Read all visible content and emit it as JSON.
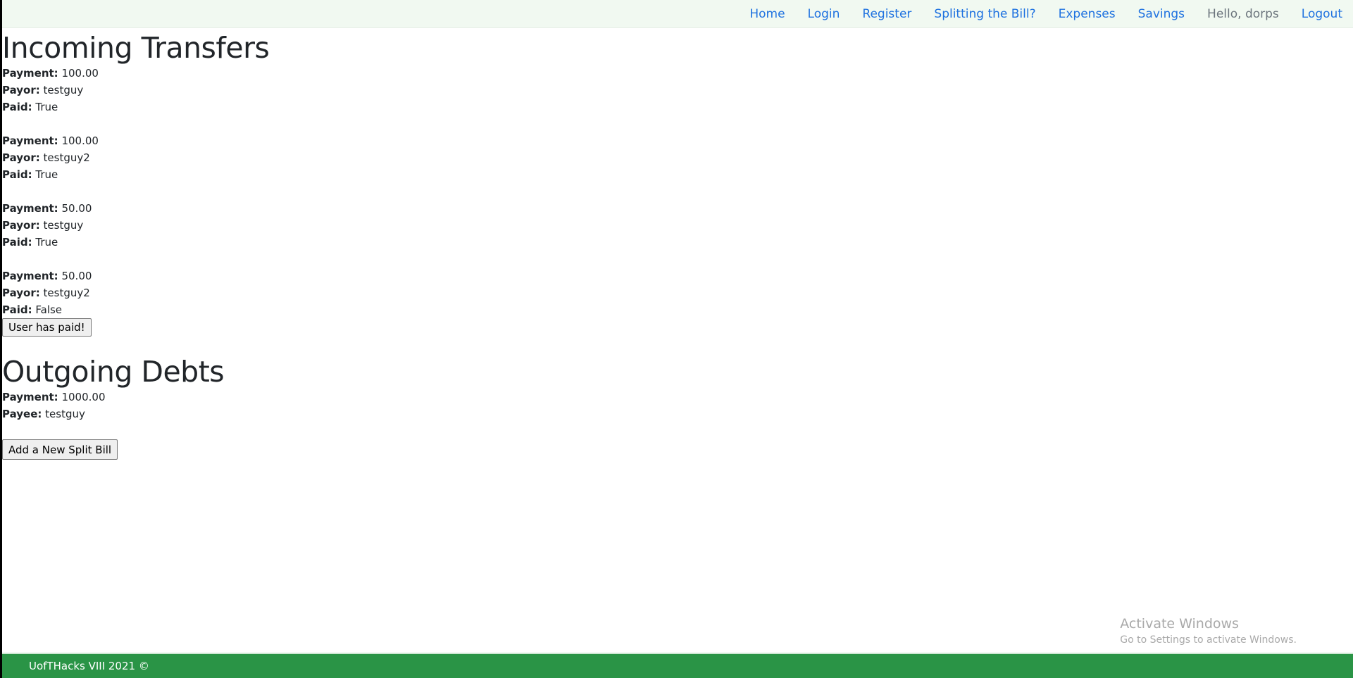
{
  "nav": {
    "links": [
      "Home",
      "Login",
      "Register",
      "Splitting the Bill?",
      "Expenses",
      "Savings"
    ],
    "greeting": "Hello, dorps",
    "logout": "Logout"
  },
  "incoming": {
    "title": "Incoming Transfers",
    "labels": {
      "payment": "Payment:",
      "payor": "Payor:",
      "paid": "Paid:"
    },
    "records": [
      {
        "payment": "100.00",
        "payor": "testguy",
        "paid": "True"
      },
      {
        "payment": "100.00",
        "payor": "testguy2",
        "paid": "True"
      },
      {
        "payment": "50.00",
        "payor": "testguy",
        "paid": "True"
      },
      {
        "payment": "50.00",
        "payor": "testguy2",
        "paid": "False"
      }
    ],
    "paid_button": "User has paid!"
  },
  "outgoing": {
    "title": "Outgoing Debts",
    "labels": {
      "payment": "Payment:",
      "payee": "Payee:"
    },
    "records": [
      {
        "payment": "1000.00",
        "payee": "testguy"
      }
    ]
  },
  "add_split_button": "Add a New Split Bill",
  "watermark": {
    "title": "Activate Windows",
    "subtitle": "Go to Settings to activate Windows."
  },
  "footer": {
    "text": "UofTHacks VIII 2021 ©"
  },
  "colors": {
    "nav_bg": "#f1f9f1",
    "link": "#1f72e0",
    "footer_bg": "#2a9446"
  }
}
